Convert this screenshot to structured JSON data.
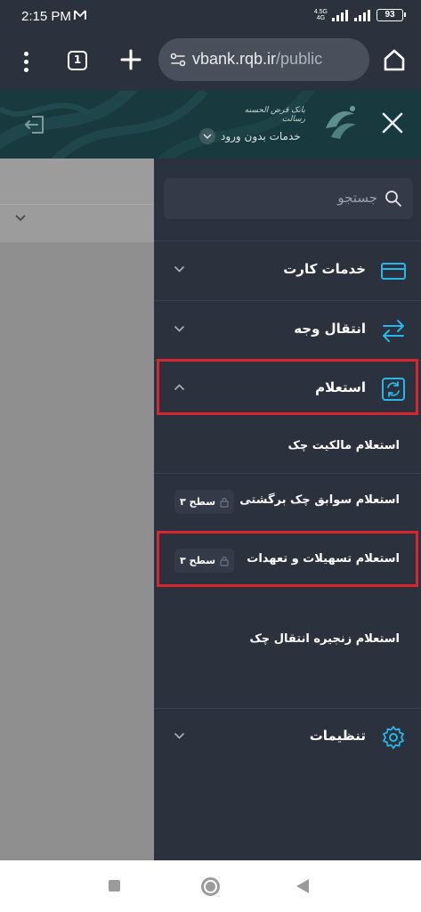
{
  "status_bar": {
    "time": "2:15 PM",
    "network_label_top": "4.5G",
    "network_label_bottom": "4G",
    "battery": "93"
  },
  "browser": {
    "tab_count": "1",
    "url_host": "vbank.rqb.ir",
    "url_path": "/public"
  },
  "header": {
    "bank_name": "بانک قرض الحسنه رسالت",
    "no_login_label": "خدمات بدون ورود"
  },
  "search": {
    "placeholder": "جستجو"
  },
  "menu": {
    "card_services": "خدمات کارت",
    "money_transfer": "انتقال وجه",
    "inquiry": "استعلام",
    "settings": "تنظیمات"
  },
  "inquiry_items": [
    {
      "label": "استعلام مالکیت چک"
    },
    {
      "label": "استعلام سوابق چک برگشتی",
      "badge": "سطح ۳"
    },
    {
      "label": "استعلام تسهیلات و تعهدات",
      "badge": "سطح ۳"
    },
    {
      "label": "استعلام زنجیره انتقال چک"
    }
  ],
  "colors": {
    "accent": "#29b6e8",
    "highlight": "#d7262e",
    "menu_background": "#2b313d",
    "header_background": "#183a3e"
  }
}
